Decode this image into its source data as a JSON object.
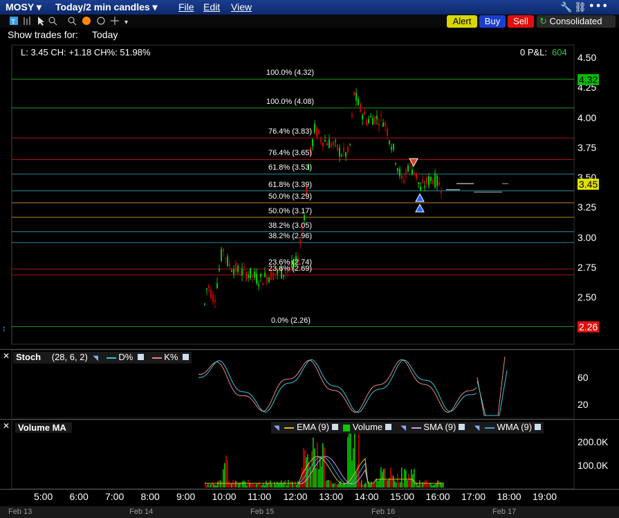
{
  "header": {
    "symbol": "MOSY",
    "period": "Today/2 min candles",
    "menu": [
      "File",
      "Edit",
      "View"
    ],
    "alert": "Alert",
    "buy": "Buy",
    "sell": "Sell",
    "consolidated": "Consolidated"
  },
  "subheader": {
    "show_trades_label": "Show trades for:",
    "show_trades_value": "Today"
  },
  "quote": {
    "text": "L: 3.45 CH: +1.18 CH%: 51.98%",
    "pl_label": "0 P&L:",
    "pl_value": "604"
  },
  "price_axis": {
    "ticks": [
      "4.50",
      "4.25",
      "4.00",
      "3.75",
      "3.50",
      "3.25",
      "3.00",
      "2.75",
      "2.50"
    ],
    "badge_high": "4.32",
    "badge_last": "3.45",
    "badge_low": "2.26"
  },
  "fib_labels": [
    "100.0% (4.32)",
    "100.0% (4.08)",
    "76.4% (3.83)",
    "76.4% (3.65)",
    "61.8% (3.53)",
    "61.8% (3.39)",
    "50.0% (3.29)",
    "50.0% (3.17)",
    "38.2% (3.05)",
    "38.2% (2.96)",
    "23.6% (2.74)",
    "23.6% (2.69)",
    "0.0% (2.26)"
  ],
  "stoch": {
    "title": "Stoch",
    "params": "(28, 6, 2)",
    "d_label": "D%",
    "k_label": "K%",
    "ticks": [
      "60",
      "20"
    ]
  },
  "volume": {
    "title": "Volume MA",
    "ema": "EMA (9)",
    "vol": "Volume",
    "sma": "SMA (9)",
    "wma": "WMA (9)",
    "ticks": [
      "200.0K",
      "100.0K"
    ]
  },
  "time_axis": [
    "5:00",
    "6:00",
    "7:00",
    "8:00",
    "9:00",
    "10:00",
    "11:00",
    "12:00",
    "13:00",
    "14:00",
    "15:00",
    "16:00",
    "17:00",
    "18:00",
    "19:00"
  ],
  "date_axis": [
    "Feb 13",
    "Feb 14",
    "Feb 15",
    "Feb 16",
    "Feb 17"
  ],
  "colors": {
    "up": "#00cc00",
    "down": "#cc0000",
    "fib_green": "#1e9a1e",
    "fib_red": "#b01010",
    "fib_teal": "#2a8a99",
    "fib_orange": "#c08020"
  },
  "icons": [
    "dropdown-icon",
    "chart-type-icon",
    "crosshair-icon",
    "zoom-in-icon",
    "zoom-out-icon",
    "record-icon",
    "link-icon",
    "settings-icon"
  ]
}
